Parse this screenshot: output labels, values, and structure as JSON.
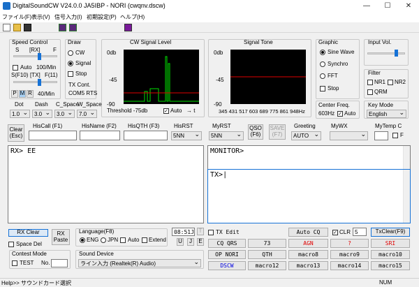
{
  "window": {
    "title": "DigitalSoundCW V24.0.0 JA5IBP - NORI (cwqnv.dscw)"
  },
  "menu": [
    "ファイル(F)",
    "表示(V)",
    "信号入力(I)",
    "初期設定(P)",
    "ヘルプ(H)"
  ],
  "speed": {
    "title": "Speed Control",
    "s_label": "S",
    "rx_label": "[RX]",
    "f_label": "F",
    "auto_label": "Auto",
    "auto_value": "100/Min",
    "s9_label": "S(F10)",
    "tx_label": "[TX]",
    "f11_label": "F(11)",
    "p": "P",
    "m": "M",
    "r": "R",
    "wpm": "40/Min"
  },
  "draw": {
    "title": "Draw",
    "cw": "CW",
    "signal": "Signal",
    "stop": "Stop",
    "txcont_label": "TX Cont.",
    "txcont_value": "COM5 RTS"
  },
  "cwsignal": {
    "title": "CW Signal Level",
    "y_top": "0db",
    "y_mid": "-45",
    "y_bot": "-90",
    "threshold": "Threshold -75db",
    "auto": "Auto",
    "arrow": "→ t"
  },
  "signaltone": {
    "title": "Signal Tone",
    "y_top": "0db",
    "y_mid": "-45",
    "y_bot": "-90",
    "freqs": "345 431 517 603 689 775 861 948Hz"
  },
  "graphic": {
    "title": "Graphic",
    "sine": "Sine Wave",
    "synchro": "Synchro",
    "fft": "FFT",
    "stop": "Stop"
  },
  "centerfreq": {
    "title": "Center Freq.",
    "value": "603Hz",
    "auto": "Auto"
  },
  "inputvol": {
    "title": "Input Vol."
  },
  "filter": {
    "title": "Filter",
    "nr1": "NR1",
    "nr2": "NR2",
    "qrm": "QRM"
  },
  "keymode": {
    "title": "Key Mode",
    "value": "English"
  },
  "dot": {
    "label": "Dot",
    "value": "1.0"
  },
  "dash": {
    "label": "Dash",
    "value": "3.0"
  },
  "cspace": {
    "label": "C_Space",
    "value": "3.0"
  },
  "wspace": {
    "label": "W_Space",
    "value": "7.0"
  },
  "row2": {
    "clear": "Clear (Esc)",
    "hiscall": "HisCall  (F1)",
    "hisname": "HisName (F2)",
    "hisqth": "HisQTH (F3)",
    "hisrst": "HisRST",
    "hisrst_value": "5NN",
    "myrst": "MyRST",
    "myrst_value": "5NN",
    "qso": "QSO (F6)",
    "save": "SAVE (F7)",
    "greeting": "Greeting",
    "greeting_value": "AUTO",
    "mywx": "MyWX",
    "mytemp": "MyTemp C",
    "f": "F"
  },
  "rxtext": "RX> EE",
  "monitor": "MONITOR>",
  "txtext": "TX>",
  "bottom": {
    "rxclear": "RX Clear",
    "rxpaste": "RX Paste",
    "spacedel": "Space Del",
    "language_title": "Language(F8)",
    "eng": "ENG",
    "jpn": "JPN",
    "auto": "Auto",
    "extend": "Extend",
    "time": "08:51J",
    "t": "T",
    "u": "U",
    "j": "J",
    "e": "E",
    "txedit": "TX Edit",
    "contest_title": "Contest Mode",
    "test": "TEST",
    "no": "No.",
    "sounddev_title": "Sound Device",
    "sounddev_value": "ライン入力 (Realtek(R) Audio)",
    "autocq": "Auto CQ",
    "clr": "CLR",
    "clr_num": "5",
    "txclear": "TxClear(F9)"
  },
  "macros": [
    [
      "CQ QRS",
      "73",
      "AGN",
      "?",
      "SRI"
    ],
    [
      "OP NORI",
      "QTH",
      "macro8",
      "macro9",
      "macro10"
    ],
    [
      "DSCW",
      "macro12",
      "macro13",
      "macro14",
      "macro15"
    ]
  ],
  "colors": {
    "red": "#e00000",
    "blue": "#0000e0",
    "accent": "#1672d6"
  },
  "status": {
    "left": "Help>> サウンドカード選択",
    "num": "NUM"
  }
}
